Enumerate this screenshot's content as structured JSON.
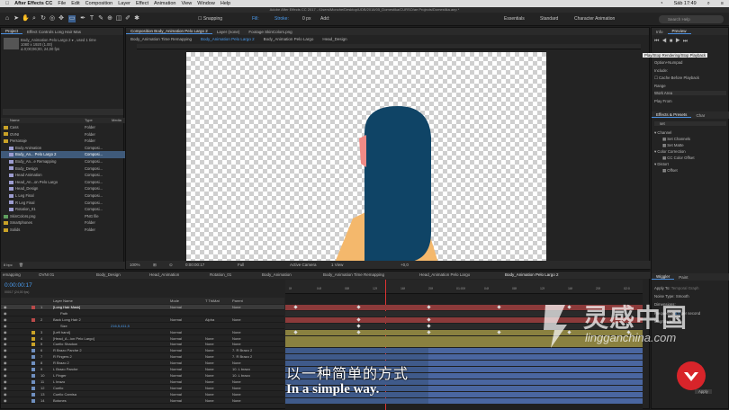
{
  "menubar": {
    "app": "After Effects CC",
    "items": [
      "File",
      "Edit",
      "Composition",
      "Layer",
      "Effect",
      "Animation",
      "View",
      "Window",
      "Help"
    ],
    "right": "Sáb 17:49"
  },
  "titlebar": "Adobe After Effects CC 2017 - /Users/Monche/Desktop/UDB/2018/05_Domestika/CURSO/ae Projects/Domestika.aep *",
  "toolbar": {
    "snapping": "Snapping",
    "fill": "Fill:",
    "stroke": "Stroke:",
    "stroke_px": "0 px",
    "add": "Add:",
    "workspaces": [
      "Essentials",
      "Standard",
      "Character Animation"
    ],
    "search_placeholder": "Search Help"
  },
  "project": {
    "tabs": [
      "Project",
      "Effect Controls Long Hair Mas"
    ],
    "selected_name": "Body_Animation Pelo Largo 2 ▾ , used 1 time",
    "selected_size": "1080 x 1920 (1.00)",
    "selected_duration": "Δ 0;00;06;00, 24,00 fps",
    "columns": [
      "Name",
      "Type",
      "Media"
    ],
    "items": [
      {
        "name": "Cass",
        "type": "Folder",
        "color": "#c9a227",
        "indent": 0,
        "sel": false
      },
      {
        "name": "OVNI",
        "type": "Folder",
        "color": "#c9a227",
        "indent": 0,
        "sel": false
      },
      {
        "name": "Personaje",
        "type": "Folder",
        "color": "#c9a227",
        "indent": 0,
        "sel": false
      },
      {
        "name": "Body Animation",
        "type": "Composi...",
        "color": "#9c9cd0",
        "indent": 1,
        "sel": false
      },
      {
        "name": "Body_An... Pelo Largo 2",
        "type": "Composi...",
        "color": "#9c9cd0",
        "indent": 1,
        "sel": true
      },
      {
        "name": "Body_An...e Remapping",
        "type": "Composi...",
        "color": "#9c9cd0",
        "indent": 1,
        "sel": false
      },
      {
        "name": "Body_Design",
        "type": "Composi...",
        "color": "#9c9cd0",
        "indent": 1,
        "sel": false
      },
      {
        "name": "Head Animation",
        "type": "Composi...",
        "color": "#9c9cd0",
        "indent": 1,
        "sel": false
      },
      {
        "name": "Head_An...on Pelo Largo",
        "type": "Composi...",
        "color": "#9c9cd0",
        "indent": 1,
        "sel": false
      },
      {
        "name": "Head_Design",
        "type": "Composi...",
        "color": "#9c9cd0",
        "indent": 1,
        "sel": false
      },
      {
        "name": "L Leg Final",
        "type": "Composi...",
        "color": "#9c9cd0",
        "indent": 1,
        "sel": false
      },
      {
        "name": "R Leg Final",
        "type": "Composi...",
        "color": "#9c9cd0",
        "indent": 1,
        "sel": false
      },
      {
        "name": "Rotation_01",
        "type": "Composi...",
        "color": "#9c9cd0",
        "indent": 1,
        "sel": false
      },
      {
        "name": "SkinColors.png",
        "type": "PNG file",
        "color": "#5f9f5f",
        "indent": 0,
        "sel": false
      },
      {
        "name": "Smartphones",
        "type": "Folder",
        "color": "#c9a227",
        "indent": 0,
        "sel": false
      },
      {
        "name": "Solids",
        "type": "Folder",
        "color": "#c9a227",
        "indent": 0,
        "sel": false
      }
    ],
    "footer": "8 bpc"
  },
  "composition": {
    "tabs": [
      "Composition Body_Animation Pelo Largo 2",
      "Layer (none)",
      "Footage SkinColors.png"
    ],
    "breadcrumbs": [
      "Body_Animation Time Remapping",
      "Body_Animation Pelo Largo 2",
      "Body_Animation Pelo Largo",
      "Head_Design"
    ],
    "zoom": "100%",
    "timecode": "0:00:00:17",
    "resolution": "Full",
    "camera": "Active Camera",
    "views": "1 View",
    "exposure": "+0,0",
    "colors": {
      "hair": "#0f4466",
      "skin": "#f4b86c",
      "cheek": "#f08a86"
    }
  },
  "right_panel": {
    "tabs_top": [
      "Info",
      "Preview"
    ],
    "shortcut_label": "Shortcut",
    "tooltip": "Play/Stop Rendering/Stop Playback",
    "option": "Option+Numpad",
    "include": "Include:",
    "cache": "Cache Before Playback",
    "range": "Range",
    "range_value": "Work Area",
    "play_from": "Play From",
    "effects_tabs": [
      "Effects & Presets",
      "Char"
    ],
    "effects_search": "set",
    "effects": [
      "Channel",
      "Set Channels",
      "Set Matte",
      "Color Correction",
      "CC Color Offset",
      "Distort",
      "Offset"
    ],
    "wiggler_tabs": [
      "Wiggler",
      "Paint"
    ],
    "apply_to": "Apply To:",
    "apply_to_value": "Temporal Graph",
    "noise_type": "Noise Type:",
    "noise_value": "Smooth",
    "dimensions": "Dimensions:",
    "frequency": "Frequency:",
    "freq_value": "5,0",
    "per_second": "per second",
    "magnitude": "Magnitude:",
    "apply": "Apply"
  },
  "timeline": {
    "tabs": [
      "emapping",
      "OVNI 01",
      "Body_Design",
      "Head_Animation",
      "Rotation_01",
      "Body_Animation",
      "Body_Animation Time Remapping",
      "Head_Animation Pelo Largo",
      "Body_Animation Pelo Largo 2"
    ],
    "timecode": "0:00:00:17",
    "fps": "00017 (24,00 fps)",
    "columns": [
      "Layer Name",
      "Mode",
      "T TrkMat",
      "Parent"
    ],
    "ruler": [
      "0f",
      "04f",
      "08f",
      "12f",
      "16f",
      "20f",
      "01:00f",
      "04f",
      "08f",
      "12f",
      "16f",
      "20f",
      "02:0"
    ],
    "layers": [
      {
        "num": "1",
        "name": "[Long Hair Mask]",
        "mode": "Normal",
        "trk": "",
        "parent": "None",
        "color": "#b94a4a",
        "sel": true
      },
      {
        "num": "",
        "name": "Path",
        "mode": "",
        "trk": "",
        "parent": "",
        "color": "",
        "sel": false
      },
      {
        "num": "2",
        "name": "Back Long Hair 2",
        "mode": "Normal",
        "trk": "Alpha",
        "parent": "None",
        "color": "#b94a4a",
        "sel": false
      },
      {
        "num": "",
        "name": "Size",
        "mode": "",
        "trk": "",
        "parent": "",
        "color": "",
        "sel": false
      },
      {
        "num": "3",
        "name": "[Left hand]",
        "mode": "Normal",
        "trk": "",
        "parent": "None",
        "color": "#c9a227",
        "sel": false
      },
      {
        "num": "4",
        "name": "[Head_A...ion Pelo Largo]",
        "mode": "Normal",
        "trk": "None",
        "parent": "None",
        "color": "#c9a227",
        "sel": false
      },
      {
        "num": "5",
        "name": "Cuello Shadow",
        "mode": "Normal",
        "trk": "None",
        "parent": "None",
        "color": "#c9a227",
        "sel": false
      },
      {
        "num": "6",
        "name": "R Brazo Parche 2",
        "mode": "Normal",
        "trk": "None",
        "parent": "7. R Brazo 2",
        "color": "#6f8fbf",
        "sel": false
      },
      {
        "num": "7",
        "name": "R Fingers 2",
        "mode": "Normal",
        "trk": "None",
        "parent": "7. R Brazo 2",
        "color": "#6f8fbf",
        "sel": false
      },
      {
        "num": "8",
        "name": "R Brazo 2",
        "mode": "Normal",
        "trk": "None",
        "parent": "None",
        "color": "#6f8fbf",
        "sel": false
      },
      {
        "num": "9",
        "name": "L Brazo Parche",
        "mode": "Normal",
        "trk": "None",
        "parent": "10. L brazo",
        "color": "#6f8fbf",
        "sel": false
      },
      {
        "num": "10",
        "name": "L Finger",
        "mode": "Normal",
        "trk": "None",
        "parent": "10. L brazo",
        "color": "#6f8fbf",
        "sel": false
      },
      {
        "num": "11",
        "name": "L brazo",
        "mode": "Normal",
        "trk": "None",
        "parent": "None",
        "color": "#6f8fbf",
        "sel": false
      },
      {
        "num": "12",
        "name": "Cuello",
        "mode": "Normal",
        "trk": "None",
        "parent": "None",
        "color": "#6f8fbf",
        "sel": false
      },
      {
        "num": "13",
        "name": "Cuello Camisa",
        "mode": "Normal",
        "trk": "None",
        "parent": "None",
        "color": "#6f8fbf",
        "sel": false
      },
      {
        "num": "14",
        "name": "Botones",
        "mode": "Normal",
        "trk": "None",
        "parent": "None",
        "color": "#6f8fbf",
        "sel": false
      }
    ],
    "size_value": "216,5,411,5"
  },
  "subtitles": {
    "zh": "以一种简单的方式",
    "en": "In a simple way."
  },
  "watermark": {
    "text": "灵感中国",
    "url": "lingganchina.com"
  }
}
